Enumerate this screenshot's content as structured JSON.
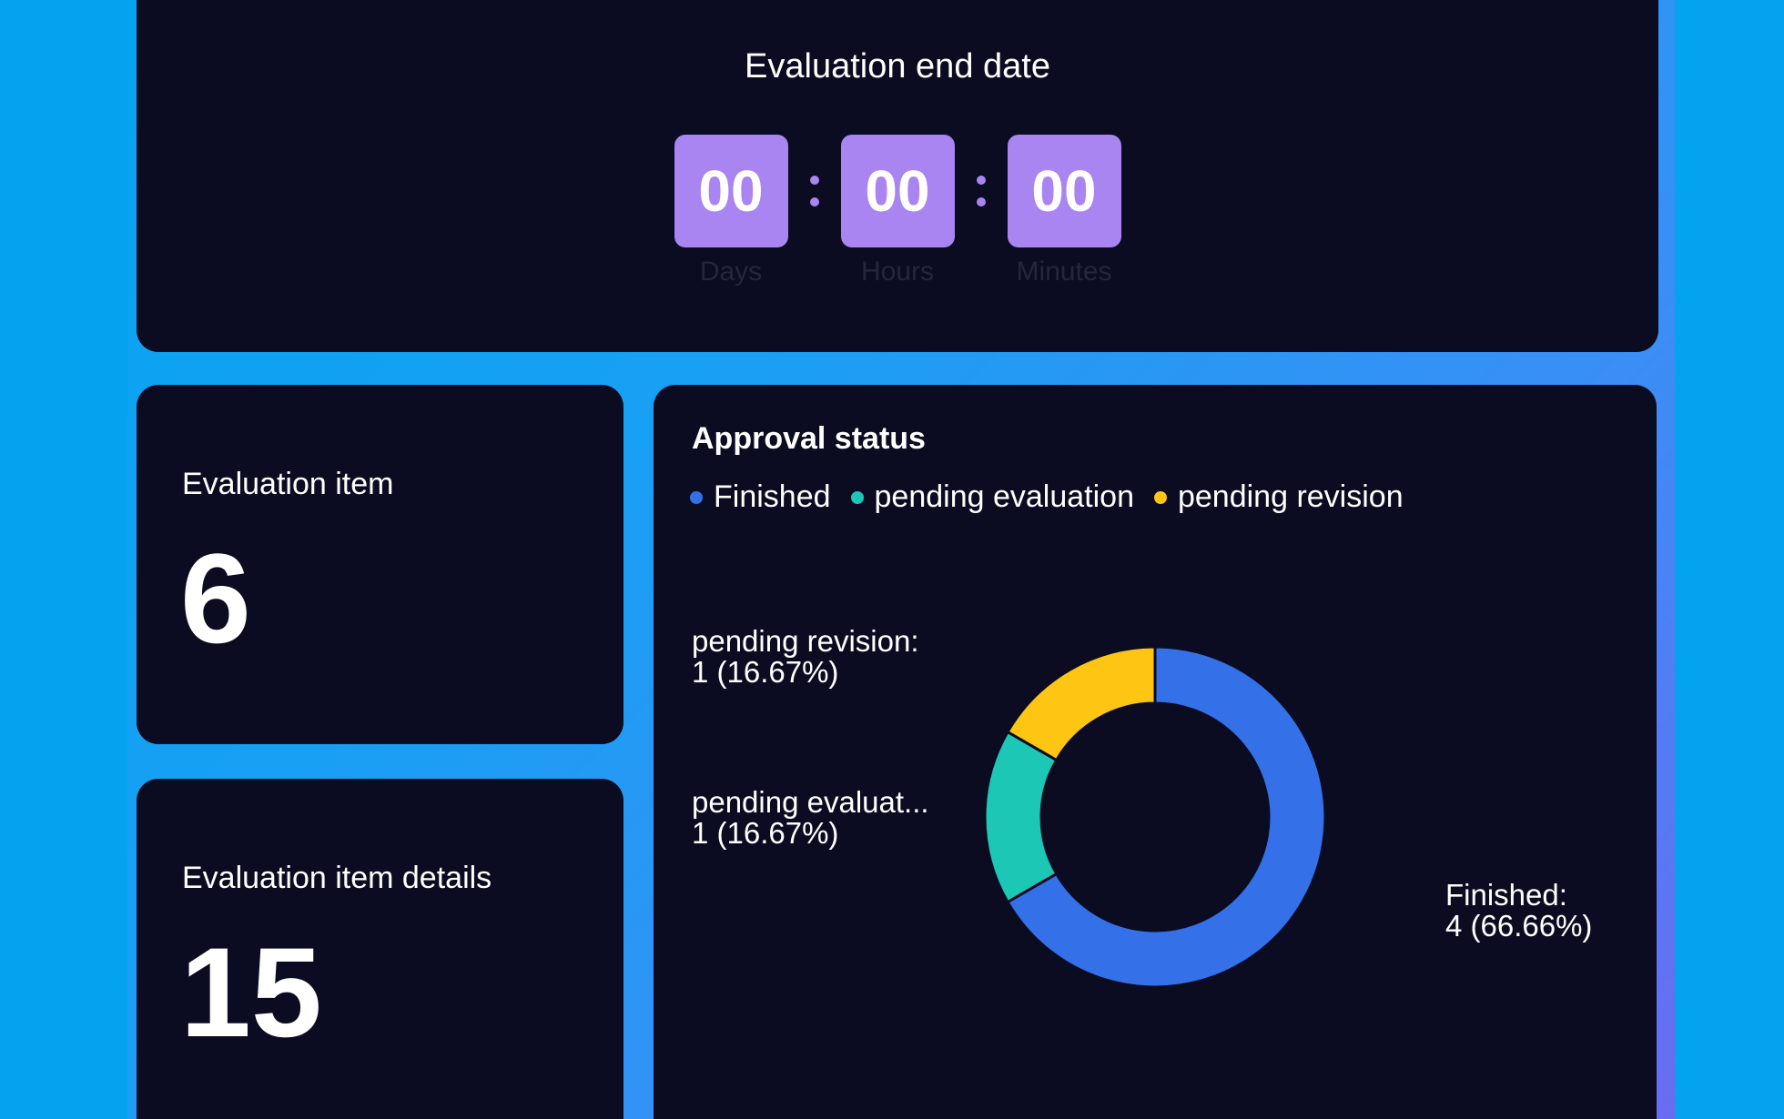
{
  "countdown": {
    "title": "Evaluation end date",
    "units": [
      {
        "value": "00",
        "label": "Days"
      },
      {
        "value": "00",
        "label": "Hours"
      },
      {
        "value": "00",
        "label": "Minutes"
      }
    ],
    "separator": ":"
  },
  "stats": {
    "evaluation_item": {
      "label": "Evaluation item",
      "value": "6"
    },
    "evaluation_item_details": {
      "label": "Evaluation item details",
      "value": "15"
    }
  },
  "approval": {
    "title": "Approval status",
    "legend": [
      {
        "name": "Finished",
        "color": "#3470e8"
      },
      {
        "name": "pending evaluation",
        "color": "#1cc7b6"
      },
      {
        "name": "pending revision",
        "color": "#fec512"
      }
    ]
  },
  "chart_data": {
    "type": "pie",
    "title": "Approval status",
    "legend_position": "top-left",
    "donut": true,
    "slices": [
      {
        "name": "Finished",
        "value": 4,
        "percent": "66.66%",
        "color": "#3470e8",
        "label_line1": "Finished:",
        "label_line2": "4 (66.66%)"
      },
      {
        "name": "pending evaluation",
        "value": 1,
        "percent": "16.67%",
        "color": "#1cc7b6",
        "label_line1": "pending evaluat...",
        "label_line2": "1 (16.67%)"
      },
      {
        "name": "pending revision",
        "value": 1,
        "percent": "16.67%",
        "color": "#fec512",
        "label_line1": "pending revision:",
        "label_line2": "1 (16.67%)"
      }
    ]
  }
}
